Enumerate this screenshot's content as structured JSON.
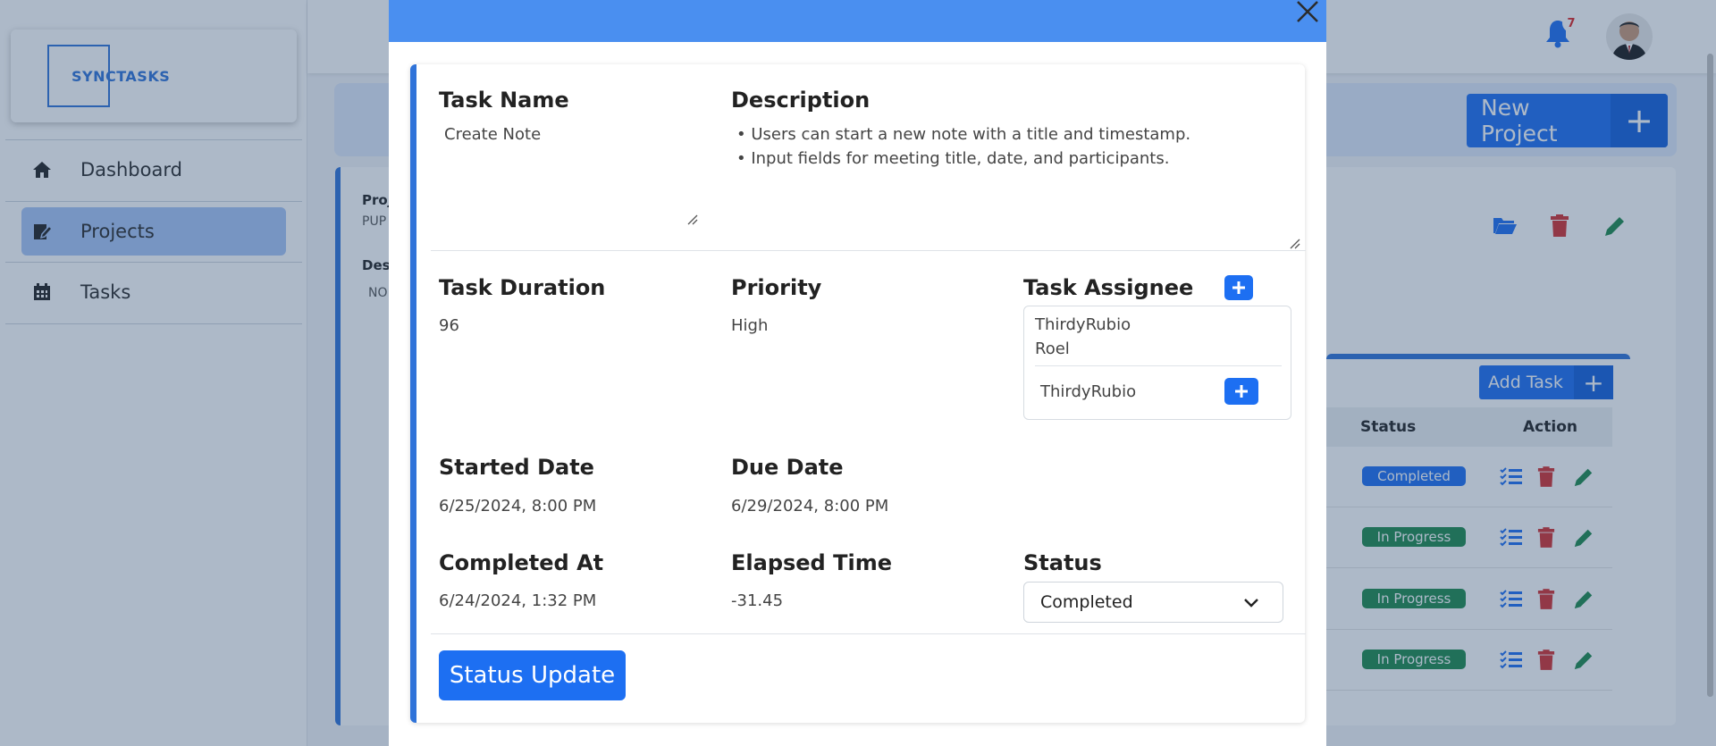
{
  "app": {
    "logo_text": "SYNCTASKS"
  },
  "sidebar": {
    "items": [
      {
        "label": "Dashboard",
        "icon": "home-icon"
      },
      {
        "label": "Projects",
        "icon": "projects-icon"
      },
      {
        "label": "Tasks",
        "icon": "calendar-icon"
      }
    ]
  },
  "topbar": {
    "notification_count": "7"
  },
  "page": {
    "new_project_label": "New Project",
    "project_label_prefix": "Proj",
    "project_value_prefix": "PUP",
    "desc_label_prefix": "Des",
    "desc_value_prefix": "NO",
    "add_task_label": "Add Task",
    "table_headers": {
      "status": "Status",
      "action": "Action"
    },
    "rows": [
      {
        "status": "Completed"
      },
      {
        "status": "In Progress"
      },
      {
        "status": "In Progress"
      },
      {
        "status": "In Progress"
      }
    ]
  },
  "modal": {
    "task_name_label": "Task Name",
    "task_name_value": "Create Note",
    "description_label": "Description",
    "description_lines": [
      "• Users can start a new note with a title and timestamp.",
      "• Input fields for meeting title, date, and participants."
    ],
    "task_duration_label": "Task Duration",
    "task_duration_value": "96",
    "priority_label": "Priority",
    "priority_value": "High",
    "task_assignee_label": "Task Assignee",
    "assignees": [
      "ThirdyRubio",
      "Roel"
    ],
    "assignee_select_value": "ThirdyRubio",
    "started_date_label": "Started Date",
    "started_date_value": "6/25/2024, 8:00 PM",
    "due_date_label": "Due Date",
    "due_date_value": "6/29/2024, 8:00 PM",
    "completed_at_label": "Completed At",
    "completed_at_value": "6/24/2024, 1:32 PM",
    "elapsed_time_label": "Elapsed Time",
    "elapsed_time_value": "-31.45",
    "status_label": "Status",
    "status_value": "Completed",
    "status_update_label": "Status Update"
  },
  "colors": {
    "primary": "#1d6ff2",
    "header": "#4a8ff0",
    "completed": "#1d6ff2",
    "in_progress": "#1e8a4c",
    "danger": "#d32f2f",
    "edit": "#1e8a4c"
  }
}
